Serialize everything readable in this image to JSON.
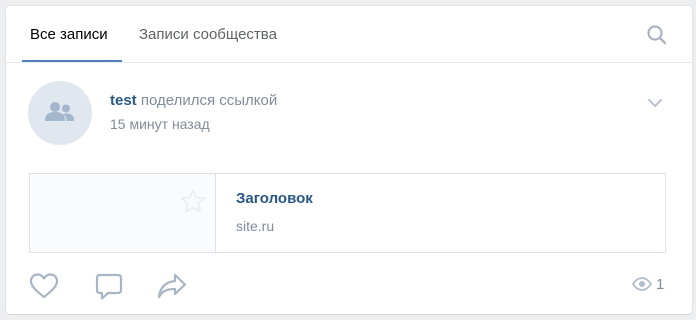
{
  "tabs": [
    {
      "label": "Все записи",
      "active": true
    },
    {
      "label": "Записи сообщества",
      "active": false
    }
  ],
  "icons": {
    "search": "search-icon",
    "avatar": "group-icon",
    "menu": "chevron-down-icon",
    "thumbnail": "star-icon",
    "like": "heart-icon",
    "comment": "comment-icon",
    "share": "share-icon",
    "views": "eye-icon"
  },
  "post": {
    "author": "test",
    "action": "поделился ссылкой",
    "time": "15 минут назад",
    "link": {
      "title": "Заголовок",
      "domain": "site.ru"
    },
    "views": "1"
  },
  "colors": {
    "accent": "#5181b8",
    "link": "#2a5885",
    "muted": "#818c99",
    "icon": "#a8b5c4"
  }
}
